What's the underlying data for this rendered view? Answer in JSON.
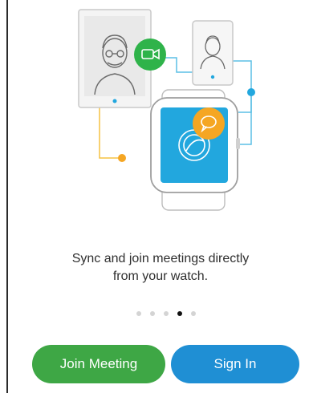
{
  "onboarding": {
    "tagline_line1": "Sync and join meetings directly",
    "tagline_line2": "from your watch.",
    "pager": {
      "count": 5,
      "active_index": 3
    },
    "join_label": "Join Meeting",
    "signin_label": "Sign In"
  },
  "colors": {
    "join_green": "#3ea745",
    "signin_blue": "#1f8fd4",
    "video_badge": "#2fb34a",
    "chat_badge": "#f5a623",
    "watch_screen": "#22a7de",
    "connector_blue": "#5bbfe5",
    "connector_yellow": "#f5c242"
  },
  "icons": [
    "video-camera-icon",
    "chat-bubble-icon",
    "meeting-app-icon"
  ]
}
